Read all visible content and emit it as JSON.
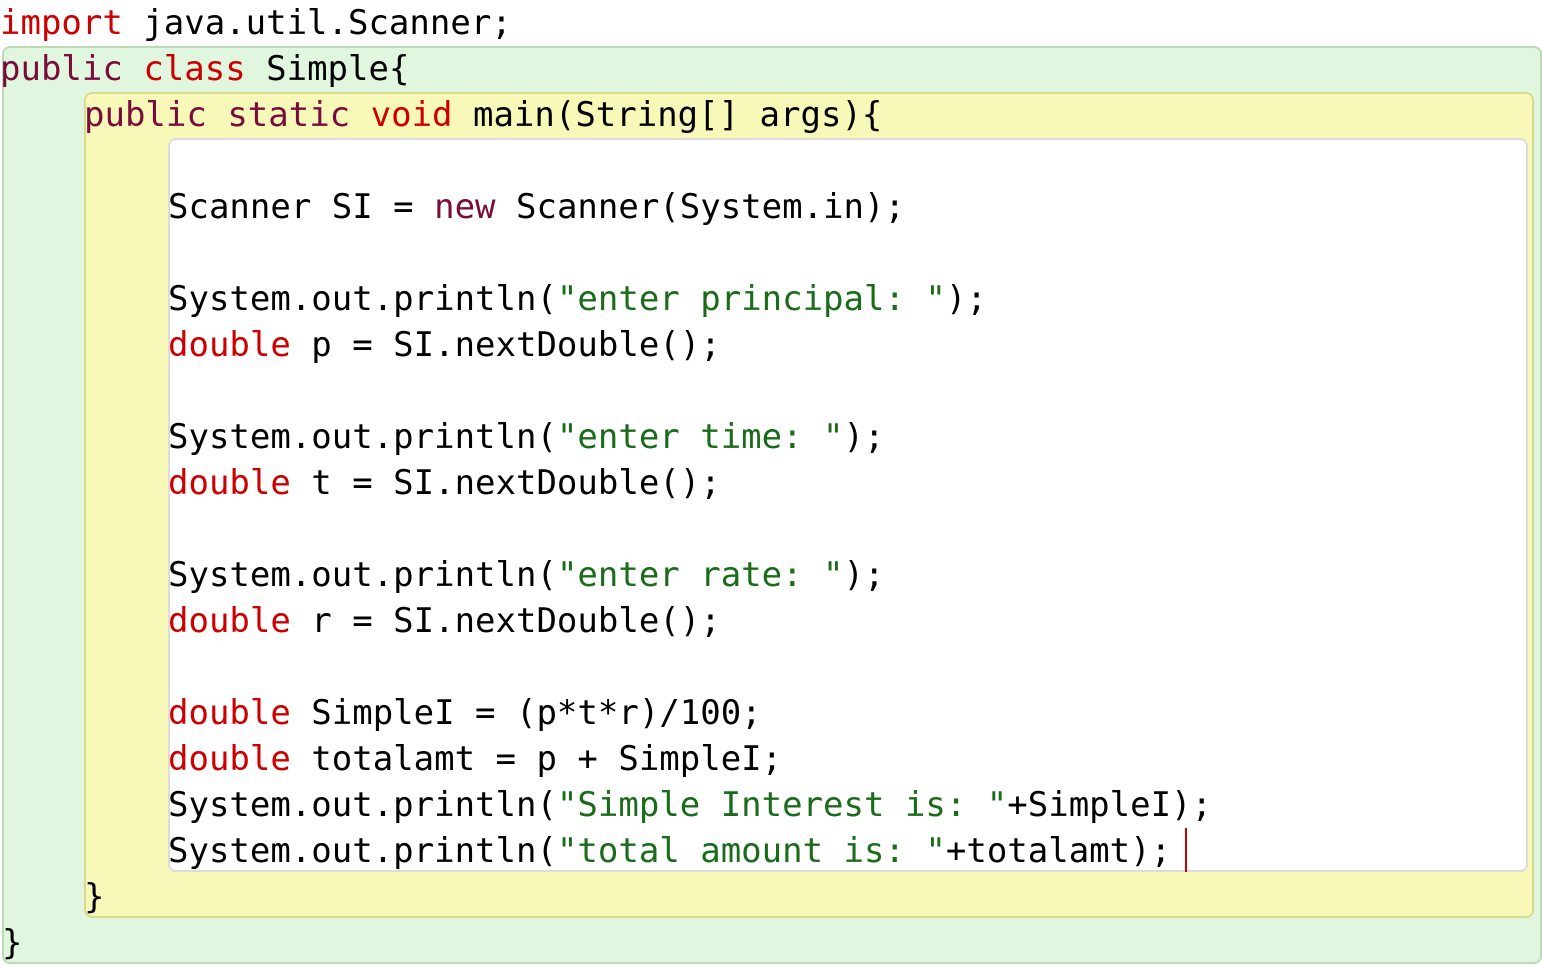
{
  "code": {
    "line1": {
      "import_kw": "import",
      "rest": " java.util.Scanner;"
    },
    "line2": {
      "public_kw": "public",
      "class_kw": "class",
      "rest": " Simple{"
    },
    "line3": {
      "public_kw": "public",
      "static_kw": "static",
      "void_kw": "void",
      "rest": " main(String[] args){"
    },
    "line5": {
      "pre": "Scanner SI = ",
      "new_kw": "new",
      "post": " Scanner(System.in);"
    },
    "line7": {
      "pre": "System.out.println(",
      "str": "\"enter principal: \"",
      "post": ");"
    },
    "line8": {
      "type_kw": "double",
      "rest": " p = SI.nextDouble();"
    },
    "line10": {
      "pre": "System.out.println(",
      "str": "\"enter time: \"",
      "post": ");"
    },
    "line11": {
      "type_kw": "double",
      "rest": " t = SI.nextDouble();"
    },
    "line13": {
      "pre": "System.out.println(",
      "str": "\"enter rate: \"",
      "post": ");"
    },
    "line14": {
      "type_kw": "double",
      "rest": " r = SI.nextDouble();"
    },
    "line16": {
      "type_kw": "double",
      "rest": " SimpleI = (p*t*r)/100;"
    },
    "line17": {
      "type_kw": "double",
      "rest": " totalamt = p + SimpleI;"
    },
    "line18": {
      "pre": "System.out.println(",
      "str": "\"Simple Interest is: \"",
      "post": "+SimpleI);"
    },
    "line19": {
      "pre": "System.out.println(",
      "str": "\"total amount is: \"",
      "post": "+totalamt);"
    },
    "line20": {
      "text": "}"
    },
    "line21": {
      "text": "}"
    }
  },
  "colors": {
    "keyword_red": "#cc0000",
    "keyword_maroon": "#7a0c3c",
    "string_green": "#1a6b1a",
    "class_scope_bg": "#e0f6de",
    "method_scope_bg": "#f8f8b8",
    "body_scope_bg": "#ffffff",
    "cursor": "#cc0000"
  }
}
